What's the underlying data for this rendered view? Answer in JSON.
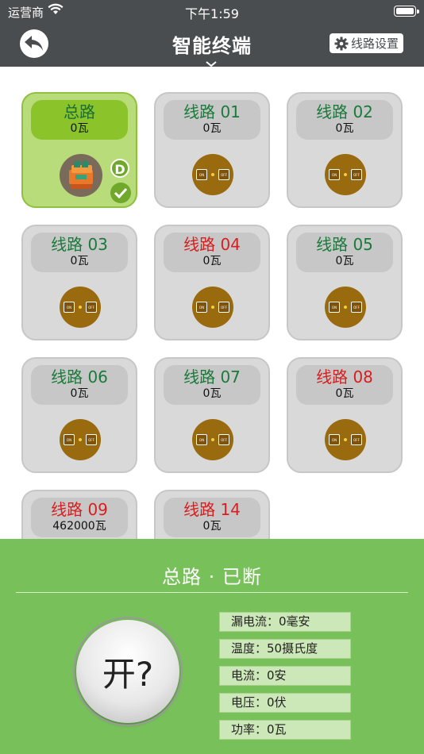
{
  "status_bar": {
    "carrier": "运营商",
    "time": "下午1:59"
  },
  "nav": {
    "title": "智能终端",
    "settings_label": "线路设置"
  },
  "tiles": [
    {
      "name": "总路",
      "power": "0瓦",
      "color": "green",
      "active": true
    },
    {
      "name": "线路 01",
      "power": "0瓦",
      "color": "green"
    },
    {
      "name": "线路 02",
      "power": "0瓦",
      "color": "green"
    },
    {
      "name": "线路 03",
      "power": "0瓦",
      "color": "green"
    },
    {
      "name": "线路 04",
      "power": "0瓦",
      "color": "red"
    },
    {
      "name": "线路 05",
      "power": "0瓦",
      "color": "green"
    },
    {
      "name": "线路 06",
      "power": "0瓦",
      "color": "green"
    },
    {
      "name": "线路 07",
      "power": "0瓦",
      "color": "green"
    },
    {
      "name": "线路 08",
      "power": "0瓦",
      "color": "red"
    },
    {
      "name": "线路 09",
      "power": "462000瓦",
      "color": "red"
    },
    {
      "name": "线路 14",
      "power": "0瓦",
      "color": "red"
    }
  ],
  "master_badge": "D",
  "switch_text": {
    "on": "ON",
    "off": "OFF"
  },
  "panel": {
    "title": "总路 · 已断",
    "button_label": "开?",
    "readings": [
      "漏电流：0毫安",
      "温度：50摄氏度",
      "电流：0安",
      "电压：0伏",
      "功率：0瓦"
    ]
  },
  "colors": {
    "nav_bg": "#4a4d50",
    "panel_bg": "#77c05a",
    "tile_active_bg": "#b9dc7b",
    "name_green": "#1a7a3a",
    "name_red": "#d71f1f",
    "switch_icon_bg": "#9a6a0e"
  }
}
